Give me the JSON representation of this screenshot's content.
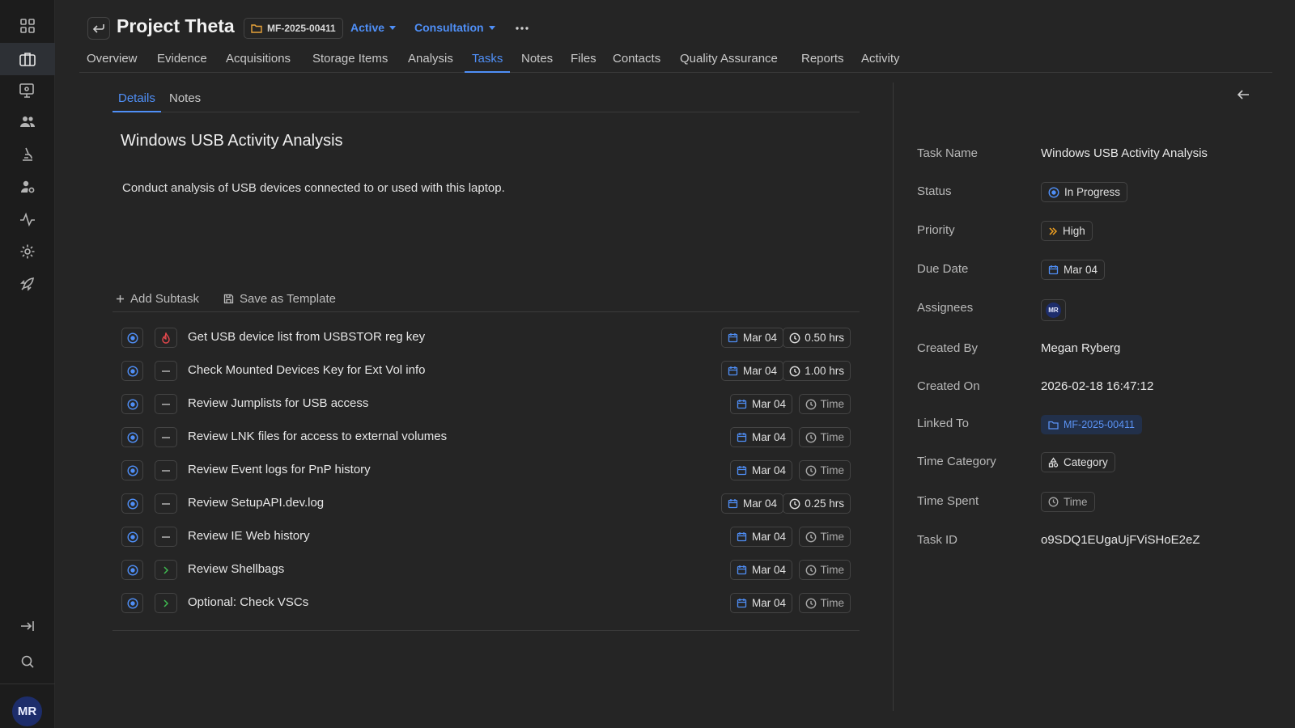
{
  "sidebar": {
    "icons": [
      "dashboard-grid-icon",
      "briefcase-icon",
      "monitor-icon",
      "users-icon",
      "microscope-icon",
      "user-gear-icon",
      "activity-icon",
      "settings-icon",
      "rocket-icon",
      "collapse-icon",
      "search-icon"
    ],
    "user_initials": "MR"
  },
  "header": {
    "title": "Project Theta",
    "case_id": "MF-2025-00411",
    "status": "Active",
    "category": "Consultation"
  },
  "tabs": [
    "Overview",
    "Evidence",
    "Acquisitions",
    "Storage Items",
    "Analysis",
    "Tasks",
    "Notes",
    "Files",
    "Contacts",
    "Quality Assurance",
    "Reports",
    "Activity"
  ],
  "active_tab": "Tasks",
  "subtabs": [
    "Details",
    "Notes"
  ],
  "task": {
    "title": "Windows USB Activity Analysis",
    "description": "Conduct analysis of USB devices connected to or used with this laptop."
  },
  "actions": {
    "add_subtask": "Add Subtask",
    "save_template": "Save as Template"
  },
  "subtasks": [
    {
      "name": "Get USB device list from USBSTOR reg key",
      "priority": "urgent",
      "date": "Mar 04",
      "time": "0.50 hrs"
    },
    {
      "name": "Check Mounted Devices Key for Ext Vol info",
      "priority": "none",
      "date": "Mar 04",
      "time": "1.00 hrs"
    },
    {
      "name": "Review Jumplists for USB access",
      "priority": "none",
      "date": "Mar 04",
      "time": "Time"
    },
    {
      "name": "Review LNK files for access to external volumes",
      "priority": "none",
      "date": "Mar 04",
      "time": "Time"
    },
    {
      "name": "Review Event logs for PnP history",
      "priority": "none",
      "date": "Mar 04",
      "time": "Time"
    },
    {
      "name": "Review SetupAPI.dev.log",
      "priority": "none",
      "date": "Mar 04",
      "time": "0.25 hrs"
    },
    {
      "name": "Review IE Web history",
      "priority": "none",
      "date": "Mar 04",
      "time": "Time"
    },
    {
      "name": "Review Shellbags",
      "priority": "low",
      "date": "Mar 04",
      "time": "Time"
    },
    {
      "name": "Optional: Check VSCs",
      "priority": "low",
      "date": "Mar 04",
      "time": "Time"
    }
  ],
  "details": {
    "task_name_label": "Task Name",
    "task_name": "Windows USB Activity Analysis",
    "status_label": "Status",
    "status": "In Progress",
    "priority_label": "Priority",
    "priority": "High",
    "due_label": "Due Date",
    "due": "Mar 04",
    "assignees_label": "Assignees",
    "assignee_initials": "MR",
    "created_by_label": "Created By",
    "created_by": "Megan Ryberg",
    "created_on_label": "Created On",
    "created_on": "2026-02-18 16:47:12",
    "linked_label": "Linked To",
    "linked": "MF-2025-00411",
    "time_cat_label": "Time Category",
    "time_cat": "Category",
    "time_spent_label": "Time Spent",
    "time_spent": "Time",
    "task_id_label": "Task ID",
    "task_id": "o9SDQ1EUgaUjFViSHoE2eZ"
  },
  "colors": {
    "accent": "#4f8ff7",
    "priority_high": "#f0a020",
    "priority_urgent": "#e5484d",
    "priority_low": "#3fb950"
  }
}
